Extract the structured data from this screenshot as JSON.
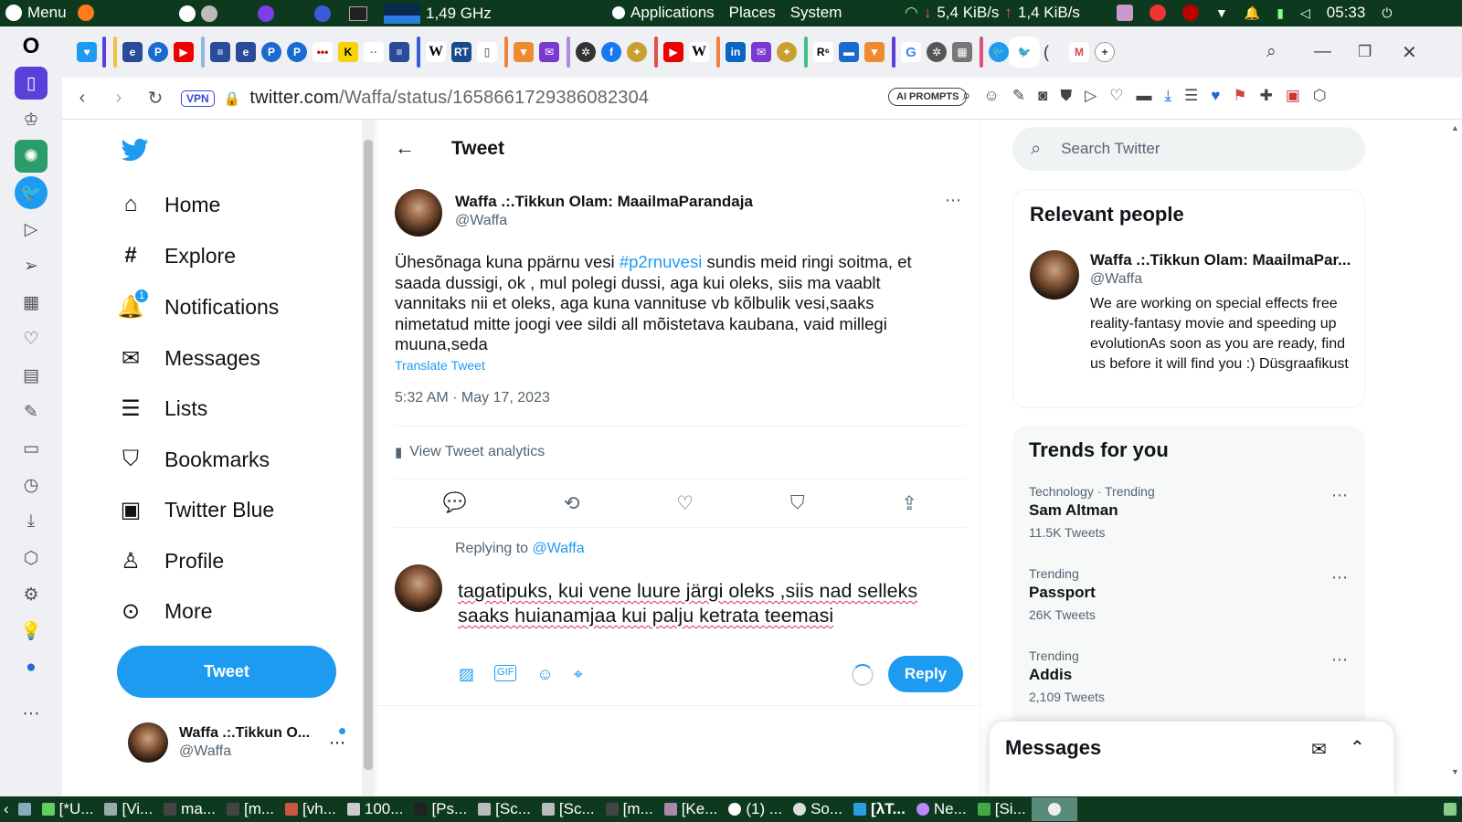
{
  "topbar": {
    "menu": "Menu",
    "cpu": "1,49 GHz",
    "applications": "Applications",
    "places": "Places",
    "system": "System",
    "net_down": "5,4 KiB/s",
    "net_up": "1,4 KiB/s",
    "clock": "05:33"
  },
  "browser": {
    "vpn": "VPN",
    "url_host": "twitter.com",
    "url_path": "/Waffa/status/1658661729386082304",
    "ai_prompts": "AI PROMPTS"
  },
  "nav": {
    "items": [
      {
        "label": "Home",
        "icon": "home-icon"
      },
      {
        "label": "Explore",
        "icon": "hashtag-icon"
      },
      {
        "label": "Notifications",
        "icon": "bell-icon",
        "badge": "1"
      },
      {
        "label": "Messages",
        "icon": "envelope-icon"
      },
      {
        "label": "Lists",
        "icon": "list-icon"
      },
      {
        "label": "Bookmarks",
        "icon": "bookmark-icon"
      },
      {
        "label": "Twitter Blue",
        "icon": "twitter-blue-icon"
      },
      {
        "label": "Profile",
        "icon": "person-icon"
      },
      {
        "label": "More",
        "icon": "more-circle-icon"
      }
    ],
    "tweet_button": "Tweet",
    "account_name": "Waffa .:.Tikkun O...",
    "account_handle": "@Waffa"
  },
  "main": {
    "header": "Tweet",
    "author_name": "Waffa .:.Tikkun Olam: MaailmaParandaja",
    "author_handle": "@Waffa",
    "text_before": "Ühesõnaga kuna ppärnu vesi ",
    "hashtag": "#p2rnuvesi",
    "text_after": " sundis meid ringi soitma, et saada dussigi, ok , mul polegi dussi, aga kui oleks, siis ma vaablt vannitaks nii et oleks, aga kuna vannituse vb kõlbulik vesi,saaks nimetatud mitte joogi vee sildi all mõistetava kaubana, vaid millegi muuna,seda",
    "translate": "Translate Tweet",
    "timestamp": "5:32 AM · May 17, 2023",
    "analytics": "View Tweet analytics",
    "replying_to_label": "Replying to",
    "replying_to_handle": "@Waffa",
    "reply_line1": "tagatipuks, kui vene luure järgi oleks ,siis nad selleks",
    "reply_line2": "saaks huianamjaa kui palju ketrata teemasi",
    "reply_button": "Reply"
  },
  "sidebar": {
    "search_placeholder": "Search Twitter",
    "relevant_title": "Relevant people",
    "person_name": "Waffa .:.Tikkun Olam: MaailmaPar...",
    "person_handle": "@Waffa",
    "person_bio": "We are working on special effects free reality-fantasy movie and speeding up evolutionAs soon as you are ready, find us before it will find you :) Düsgraafikust",
    "trends_title": "Trends for you",
    "trends": [
      {
        "meta": "Technology · Trending",
        "name": "Sam Altman",
        "count": "11.5K Tweets"
      },
      {
        "meta": "Trending",
        "name": "Passport",
        "count": "26K Tweets"
      },
      {
        "meta": "Trending",
        "name": "Addis",
        "count": "2,109 Tweets"
      }
    ],
    "messages_title": "Messages"
  },
  "taskbar": {
    "items": [
      "[*U...",
      "[Vi...",
      "ma...",
      "[m...",
      "[vh...",
      "100...",
      "[Ps...",
      "[Sc...",
      "[Sc...",
      "[m...",
      "[Ke...",
      "(1) ...",
      "So...",
      "[λT...",
      "Ne...",
      "[Si..."
    ]
  },
  "colors": {
    "accent": "#1d9bf0",
    "topbar": "#0d3a1f",
    "text": "#0f1419",
    "muted": "#536471"
  }
}
